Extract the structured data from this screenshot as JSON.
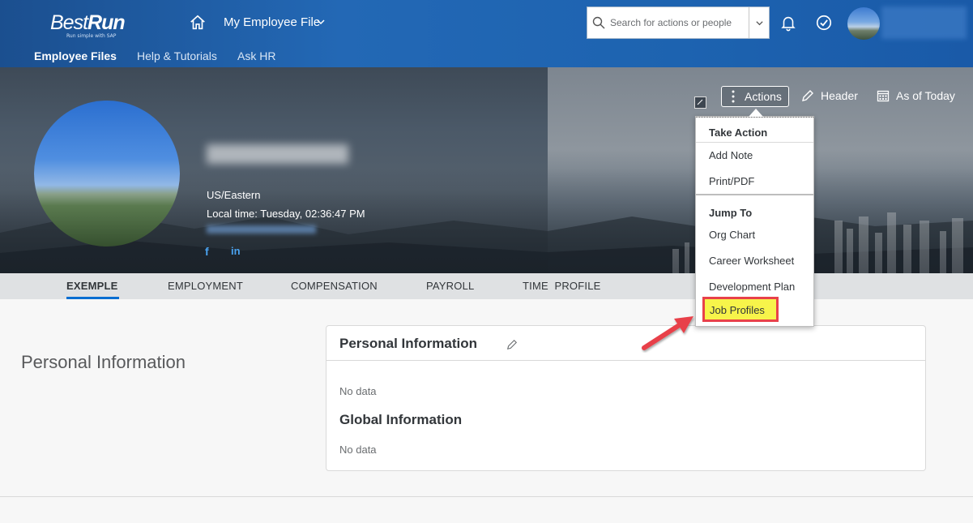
{
  "shell": {
    "logo_best": "Best",
    "logo_run": "Run",
    "logo_tagline": "Run simple with SAP",
    "app_title": "My Employee File",
    "search_placeholder": "Search for actions or people"
  },
  "subnav": {
    "items": [
      "Employee Files",
      "Help & Tutorials",
      "Ask HR"
    ],
    "active": "Employee Files"
  },
  "profile": {
    "timezone": "US/Eastern",
    "local_time": "Local time: Tuesday, 02:36:47 PM",
    "facebook": "f",
    "linkedin": "in"
  },
  "header_actions": {
    "actions": "Actions",
    "header": "Header",
    "as_of": "As of Today"
  },
  "tabs": [
    "EXEMPLE",
    "EMPLOYMENT",
    "COMPENSATION",
    "PAYROLL",
    "TIME  PROFILE"
  ],
  "content": {
    "section_title": "Personal Information",
    "card_title": "Personal Information",
    "no_data_1": "No data",
    "global_title": "Global Information",
    "no_data_2": "No data"
  },
  "menu": {
    "group1": "Take Action",
    "add_note": "Add Note",
    "print_pdf": "Print/PDF",
    "group2": "Jump To",
    "org_chart": "Org Chart",
    "career_worksheet": "Career Worksheet",
    "development_plan": "Development Plan",
    "job_profiles": "Job Profiles"
  },
  "colors": {
    "shell_blue": "#1d63b0",
    "accent": "#0a6ed1",
    "highlight_yellow": "#f7f44a",
    "highlight_red": "#e8414a",
    "arrow_red": "#e8414a"
  }
}
